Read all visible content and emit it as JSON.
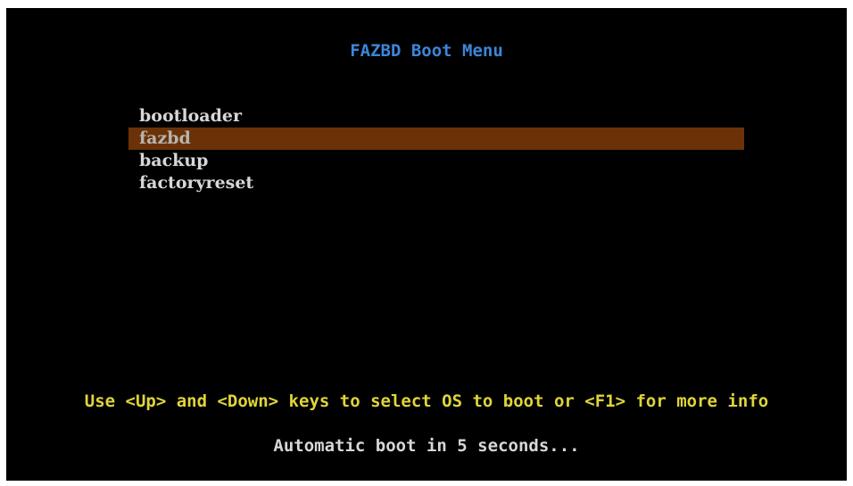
{
  "title": "FAZBD Boot Menu",
  "menu": {
    "selected_index": 1,
    "items": [
      {
        "label": "bootloader"
      },
      {
        "label": "fazbd"
      },
      {
        "label": "backup"
      },
      {
        "label": "factoryreset"
      }
    ]
  },
  "help_text": "Use <Up> and <Down> keys to select OS to boot or <F1> for more info",
  "countdown_text": "Automatic boot in 5 seconds...",
  "colors": {
    "background": "#000000",
    "title": "#3d86d8",
    "menu_text": "#d7d7d7",
    "selection_bar": "#6b3208",
    "help_text": "#e0d43a"
  }
}
